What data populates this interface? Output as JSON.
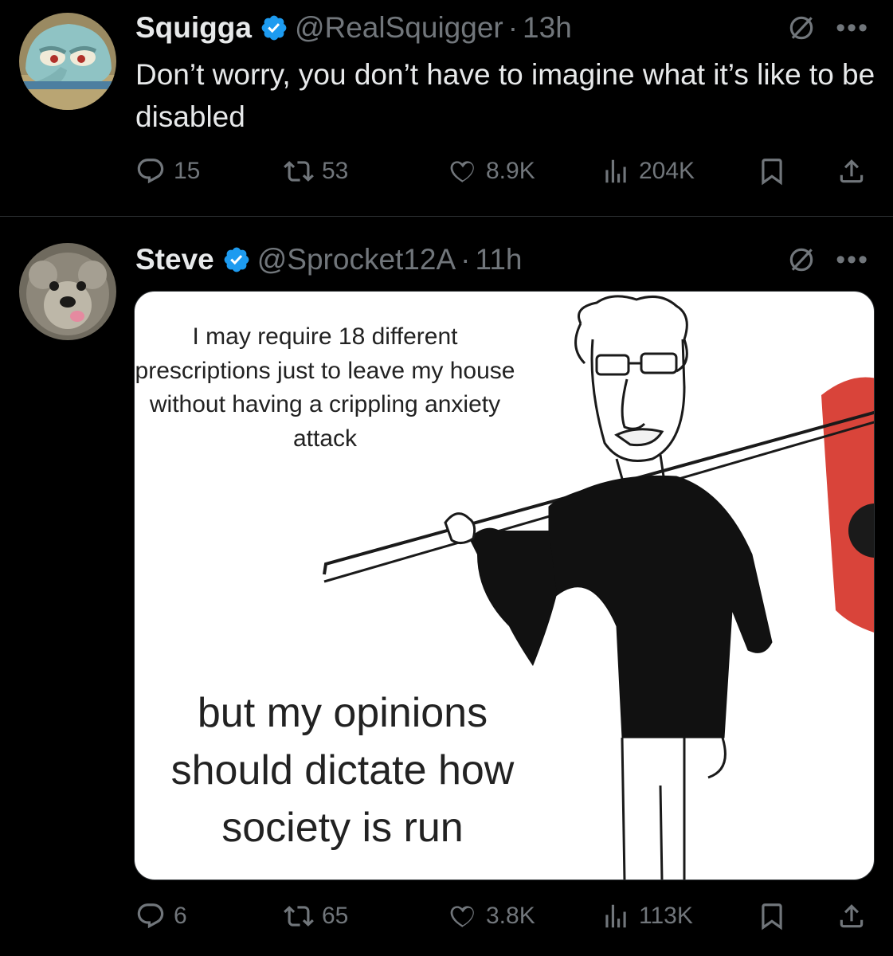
{
  "tweets": [
    {
      "name": "Squigga",
      "handle": "@RealSquigger",
      "separator": "·",
      "time": "13h",
      "text": "Don’t worry, you don’t have to imagine what it’s like to be disabled",
      "avatar": "squidward-avatar",
      "stats": {
        "replies": "15",
        "reposts": "53",
        "likes": "8.9K",
        "views": "204K"
      }
    },
    {
      "name": "Steve",
      "handle": "@Sprocket12A",
      "separator": "·",
      "time": "11h",
      "avatar": "dog-avatar",
      "meme": {
        "top_caption": "I may require 18 different prescriptions just to leave my house without having a crippling anxiety attack",
        "bottom_caption": "but my opinions should dictate how society is run"
      },
      "stats": {
        "replies": "6",
        "reposts": "65",
        "likes": "3.8K",
        "views": "113K"
      }
    }
  ],
  "colors": {
    "background": "#000000",
    "text": "#e7e9ea",
    "muted": "#71767b",
    "verified": "#1d9bf0",
    "divider": "#2f3336",
    "flag": "#d9443a"
  },
  "icons": [
    "verified-badge-icon",
    "grok-icon",
    "more-icon",
    "reply-icon",
    "repost-icon",
    "like-icon",
    "views-icon",
    "bookmark-icon",
    "share-icon"
  ]
}
